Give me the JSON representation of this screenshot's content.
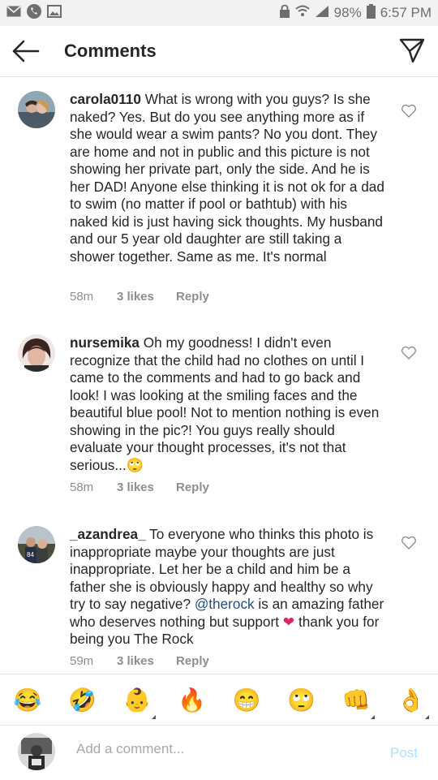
{
  "status_bar": {
    "battery": "98%",
    "time": "6:57 PM",
    "left_icons": [
      "mail-icon",
      "whatsapp-icon",
      "image-icon"
    ],
    "right_icons": [
      "lock-icon",
      "wifi-icon",
      "signal-icon",
      "battery-icon"
    ]
  },
  "header": {
    "title": "Comments",
    "back_icon": "back-arrow-icon",
    "send_icon": "direct-send-icon"
  },
  "comments": [
    {
      "username": "carola0110",
      "text": "What is wrong with you guys? Is she naked? Yes. But do you see anything more as if she would wear a swim pants? No you dont. They are home and not in public and this picture is not showing her private part, only the side. And he is her DAD! Anyone else thinking it is not ok for a dad to swim (no matter if pool or bathtub) with his naked kid is just having sick thoughts. My husband and our 5 year old daughter are still taking a shower together. Same as me. It's normal",
      "time": "58m",
      "likes": "3 likes",
      "reply": "Reply"
    },
    {
      "username": "nursemika",
      "text": "Oh my goodness! I didn't even recognize that the child had no clothes on until I came to the comments and had to go back and look! I was looking at the smiling faces and the beautiful blue pool! Not to mention nothing is even showing in the pic?! You guys really should evaluate your thought processes, it's not that serious...",
      "emoji": "🙄",
      "time": "58m",
      "likes": "3 likes",
      "reply": "Reply"
    },
    {
      "username": "_azandrea_",
      "text_before": "To everyone who thinks this photo is inappropriate maybe your thoughts are just inappropriate. Let her be a child and him be a father she is obviously happy and healthy so why try to say negative? ",
      "mention": "@therock",
      "text_middle": " is an amazing father who deserves nothing but support ",
      "heart": "❤",
      "text_after": " thank you for being you The Rock",
      "time": "59m",
      "likes": "3 likes",
      "reply": "Reply"
    }
  ],
  "emoji_bar": [
    "😂",
    "🤣",
    "👶",
    "🔥",
    "😁",
    "🙄",
    "👊",
    "👌"
  ],
  "add_comment": {
    "placeholder": "Add a comment...",
    "post_label": "Post"
  },
  "colors": {
    "post_disabled": "#b2dffc",
    "mention": "#1e4d86",
    "meta_gray": "#8e8e8e"
  }
}
